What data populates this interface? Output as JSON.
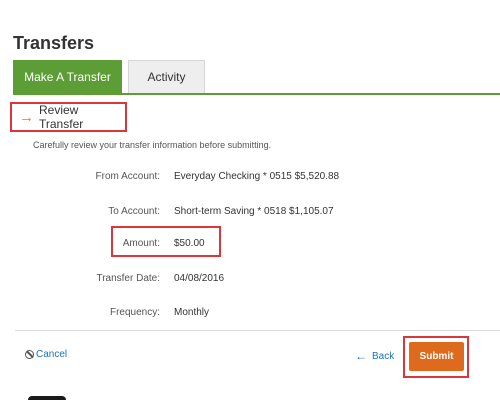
{
  "header": {
    "title": "Transfers"
  },
  "tabs": [
    {
      "label": "Make A Transfer",
      "active": true
    },
    {
      "label": "Activity",
      "active": false
    }
  ],
  "review": {
    "title": "Review Transfer",
    "instructions": "Carefully review your transfer information before submitting."
  },
  "details": {
    "from_label": "From Account:",
    "from_value": "Everyday Checking * 0515 $5,520.88",
    "to_label": "To Account:",
    "to_value": "Short-term Saving * 0518 $1,105.07",
    "amount_label": "Amount:",
    "amount_value": "$50.00",
    "date_label": "Transfer Date:",
    "date_value": "04/08/2016",
    "frequency_label": "Frequency:",
    "frequency_value": "Monthly"
  },
  "actions": {
    "cancel_label": "Cancel",
    "back_label": "Back",
    "submit_label": "Submit"
  },
  "colors": {
    "accent_green": "#5c9d36",
    "submit_orange": "#de6a1d",
    "highlight_red": "#d9373b",
    "link_blue": "#1a73b5"
  },
  "icons": {
    "review": "arrow-right-icon",
    "cancel": "cancel-circle-icon",
    "back": "arrow-left-icon"
  }
}
